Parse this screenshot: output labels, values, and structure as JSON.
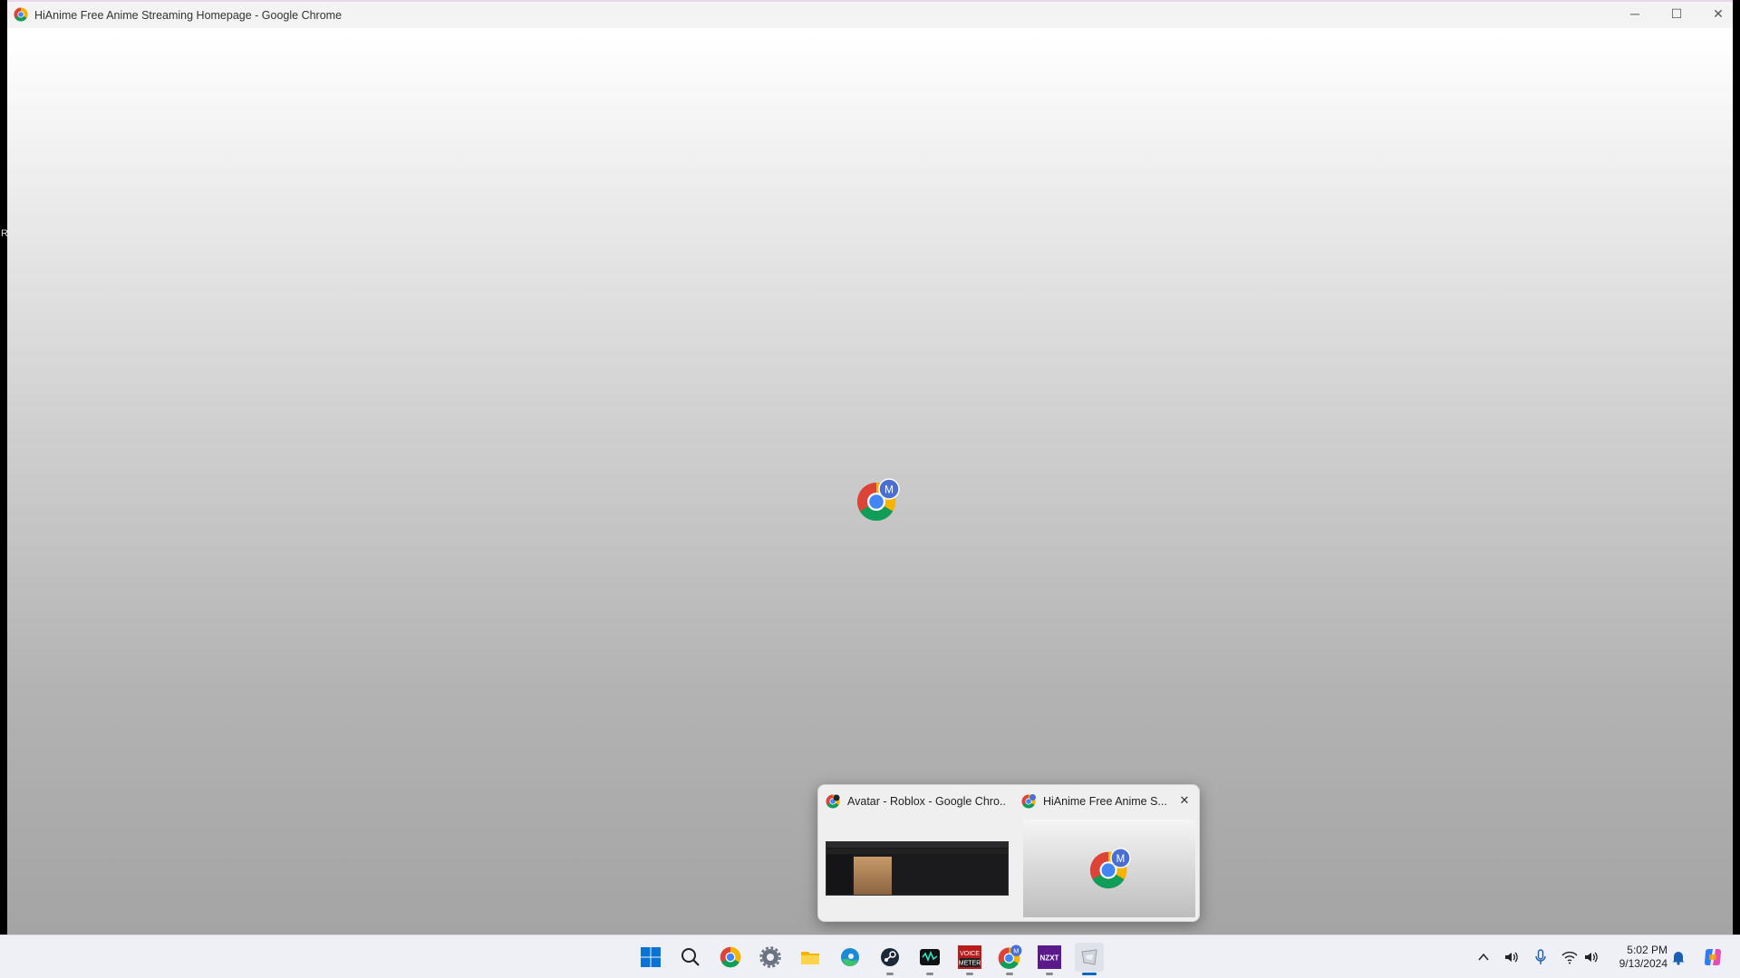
{
  "window": {
    "title": "HiAnime Free Anime Streaming Homepage - Google Chrome",
    "controls": {
      "minimize": "─",
      "maximize": "☐",
      "close": "✕"
    },
    "edge_char": "R"
  },
  "center_logo": {
    "icon": "chrome-profile-icon",
    "badge": "M"
  },
  "taskbar_preview": {
    "items": [
      {
        "label": "Avatar - Roblox - Google Chro...",
        "icon": "chrome-icon"
      },
      {
        "label": "HiAnime Free Anime S...",
        "icon": "chrome-profile-icon",
        "badge": "M",
        "close": "✕"
      }
    ]
  },
  "taskbar": {
    "apps": [
      {
        "name": "Start",
        "icon": "windows-start-icon"
      },
      {
        "name": "Search",
        "icon": "search-icon"
      },
      {
        "name": "Chrome",
        "icon": "chrome-icon"
      },
      {
        "name": "Settings",
        "icon": "gear-icon",
        "running": true
      },
      {
        "name": "File Explorer",
        "icon": "folder-icon"
      },
      {
        "name": "Edge",
        "icon": "edge-icon"
      },
      {
        "name": "Steam",
        "icon": "steam-icon",
        "running": true
      },
      {
        "name": "Wave",
        "icon": "waveform-app-icon",
        "running": true
      },
      {
        "name": "Voicemeeter",
        "icon": "voicemeeter-icon",
        "running": true,
        "label": "VOICE METER"
      },
      {
        "name": "Chrome (M)",
        "icon": "chrome-profile-icon",
        "running": true,
        "badge": "M"
      },
      {
        "name": "NZXT CAM",
        "icon": "nzxt-icon",
        "running": true,
        "label": "NZXT"
      },
      {
        "name": "App",
        "icon": "generic-app-icon",
        "active": true
      }
    ],
    "clock": {
      "time": "5:02 PM",
      "date": "9/13/2024"
    },
    "colors": {
      "accent": "#0067c0"
    }
  }
}
